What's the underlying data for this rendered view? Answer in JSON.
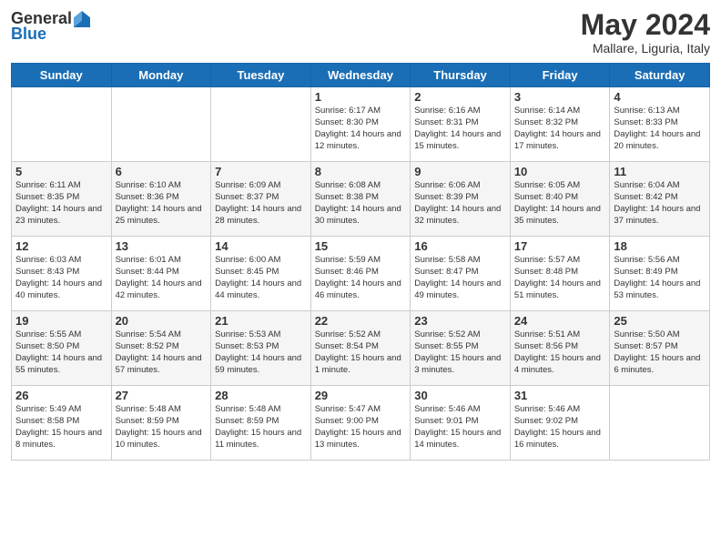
{
  "logo": {
    "general": "General",
    "blue": "Blue"
  },
  "title": "May 2024",
  "subtitle": "Mallare, Liguria, Italy",
  "days_of_week": [
    "Sunday",
    "Monday",
    "Tuesday",
    "Wednesday",
    "Thursday",
    "Friday",
    "Saturday"
  ],
  "weeks": [
    [
      {
        "day": "",
        "info": ""
      },
      {
        "day": "",
        "info": ""
      },
      {
        "day": "",
        "info": ""
      },
      {
        "day": "1",
        "info": "Sunrise: 6:17 AM\nSunset: 8:30 PM\nDaylight: 14 hours and 12 minutes."
      },
      {
        "day": "2",
        "info": "Sunrise: 6:16 AM\nSunset: 8:31 PM\nDaylight: 14 hours and 15 minutes."
      },
      {
        "day": "3",
        "info": "Sunrise: 6:14 AM\nSunset: 8:32 PM\nDaylight: 14 hours and 17 minutes."
      },
      {
        "day": "4",
        "info": "Sunrise: 6:13 AM\nSunset: 8:33 PM\nDaylight: 14 hours and 20 minutes."
      }
    ],
    [
      {
        "day": "5",
        "info": "Sunrise: 6:11 AM\nSunset: 8:35 PM\nDaylight: 14 hours and 23 minutes."
      },
      {
        "day": "6",
        "info": "Sunrise: 6:10 AM\nSunset: 8:36 PM\nDaylight: 14 hours and 25 minutes."
      },
      {
        "day": "7",
        "info": "Sunrise: 6:09 AM\nSunset: 8:37 PM\nDaylight: 14 hours and 28 minutes."
      },
      {
        "day": "8",
        "info": "Sunrise: 6:08 AM\nSunset: 8:38 PM\nDaylight: 14 hours and 30 minutes."
      },
      {
        "day": "9",
        "info": "Sunrise: 6:06 AM\nSunset: 8:39 PM\nDaylight: 14 hours and 32 minutes."
      },
      {
        "day": "10",
        "info": "Sunrise: 6:05 AM\nSunset: 8:40 PM\nDaylight: 14 hours and 35 minutes."
      },
      {
        "day": "11",
        "info": "Sunrise: 6:04 AM\nSunset: 8:42 PM\nDaylight: 14 hours and 37 minutes."
      }
    ],
    [
      {
        "day": "12",
        "info": "Sunrise: 6:03 AM\nSunset: 8:43 PM\nDaylight: 14 hours and 40 minutes."
      },
      {
        "day": "13",
        "info": "Sunrise: 6:01 AM\nSunset: 8:44 PM\nDaylight: 14 hours and 42 minutes."
      },
      {
        "day": "14",
        "info": "Sunrise: 6:00 AM\nSunset: 8:45 PM\nDaylight: 14 hours and 44 minutes."
      },
      {
        "day": "15",
        "info": "Sunrise: 5:59 AM\nSunset: 8:46 PM\nDaylight: 14 hours and 46 minutes."
      },
      {
        "day": "16",
        "info": "Sunrise: 5:58 AM\nSunset: 8:47 PM\nDaylight: 14 hours and 49 minutes."
      },
      {
        "day": "17",
        "info": "Sunrise: 5:57 AM\nSunset: 8:48 PM\nDaylight: 14 hours and 51 minutes."
      },
      {
        "day": "18",
        "info": "Sunrise: 5:56 AM\nSunset: 8:49 PM\nDaylight: 14 hours and 53 minutes."
      }
    ],
    [
      {
        "day": "19",
        "info": "Sunrise: 5:55 AM\nSunset: 8:50 PM\nDaylight: 14 hours and 55 minutes."
      },
      {
        "day": "20",
        "info": "Sunrise: 5:54 AM\nSunset: 8:52 PM\nDaylight: 14 hours and 57 minutes."
      },
      {
        "day": "21",
        "info": "Sunrise: 5:53 AM\nSunset: 8:53 PM\nDaylight: 14 hours and 59 minutes."
      },
      {
        "day": "22",
        "info": "Sunrise: 5:52 AM\nSunset: 8:54 PM\nDaylight: 15 hours and 1 minute."
      },
      {
        "day": "23",
        "info": "Sunrise: 5:52 AM\nSunset: 8:55 PM\nDaylight: 15 hours and 3 minutes."
      },
      {
        "day": "24",
        "info": "Sunrise: 5:51 AM\nSunset: 8:56 PM\nDaylight: 15 hours and 4 minutes."
      },
      {
        "day": "25",
        "info": "Sunrise: 5:50 AM\nSunset: 8:57 PM\nDaylight: 15 hours and 6 minutes."
      }
    ],
    [
      {
        "day": "26",
        "info": "Sunrise: 5:49 AM\nSunset: 8:58 PM\nDaylight: 15 hours and 8 minutes."
      },
      {
        "day": "27",
        "info": "Sunrise: 5:48 AM\nSunset: 8:59 PM\nDaylight: 15 hours and 10 minutes."
      },
      {
        "day": "28",
        "info": "Sunrise: 5:48 AM\nSunset: 8:59 PM\nDaylight: 15 hours and 11 minutes."
      },
      {
        "day": "29",
        "info": "Sunrise: 5:47 AM\nSunset: 9:00 PM\nDaylight: 15 hours and 13 minutes."
      },
      {
        "day": "30",
        "info": "Sunrise: 5:46 AM\nSunset: 9:01 PM\nDaylight: 15 hours and 14 minutes."
      },
      {
        "day": "31",
        "info": "Sunrise: 5:46 AM\nSunset: 9:02 PM\nDaylight: 15 hours and 16 minutes."
      },
      {
        "day": "",
        "info": ""
      }
    ]
  ]
}
